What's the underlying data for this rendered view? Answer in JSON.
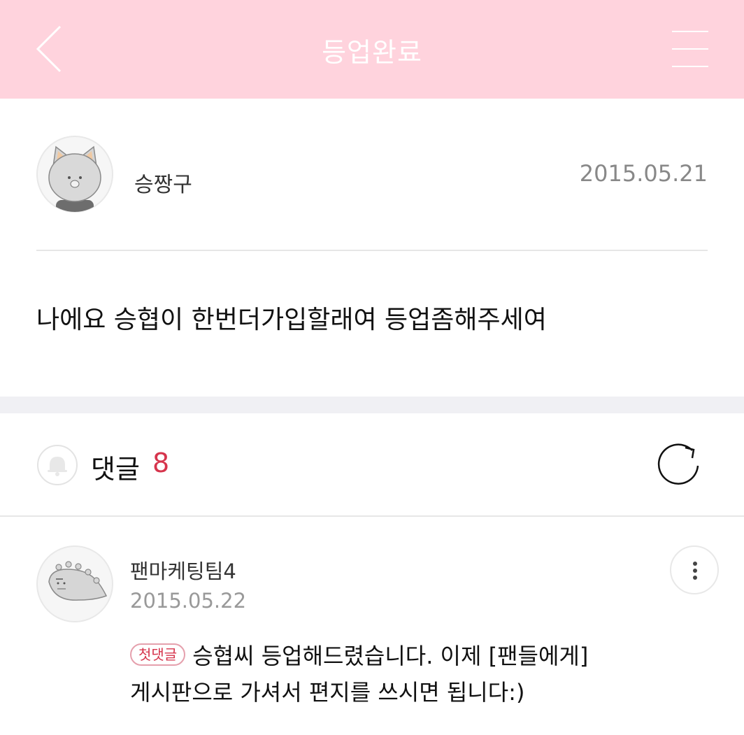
{
  "header": {
    "title": "등업완료",
    "back_icon": "chevron-left-icon",
    "menu_icon": "hamburger-menu-icon",
    "background_color": "#ffd3dd"
  },
  "post": {
    "author": "승짱구",
    "date": "2015.05.21",
    "body": "나에요 승협이 한번더가입할래여 등업좀해주세여"
  },
  "comments": {
    "label": "댓글",
    "count": "8",
    "count_color": "#d6344c",
    "refresh_icon": "refresh-icon",
    "items": [
      {
        "author": "팬마케팅팀4",
        "date": "2015.05.22",
        "badge": "첫댓글",
        "line1": "승협씨 등업해드렸습니다. 이제 [팬들에게]",
        "line2": "게시판으로 가셔서 편지를 쓰시면 됩니다:)"
      }
    ]
  }
}
